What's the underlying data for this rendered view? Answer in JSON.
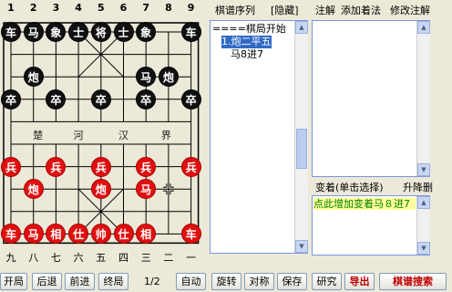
{
  "board": {
    "top_files": [
      "1",
      "2",
      "3",
      "4",
      "5",
      "6",
      "7",
      "8",
      "9"
    ],
    "bottom_files": [
      "九",
      "八",
      "七",
      "六",
      "五",
      "四",
      "三",
      "二",
      "一"
    ],
    "river": [
      "楚",
      "河",
      "汉",
      "界"
    ],
    "pieces": [
      {
        "side": "black",
        "label": "车",
        "col": 0,
        "row": 0
      },
      {
        "side": "black",
        "label": "马",
        "col": 1,
        "row": 0
      },
      {
        "side": "black",
        "label": "象",
        "col": 2,
        "row": 0
      },
      {
        "side": "black",
        "label": "士",
        "col": 3,
        "row": 0
      },
      {
        "side": "black",
        "label": "将",
        "col": 4,
        "row": 0
      },
      {
        "side": "black",
        "label": "士",
        "col": 5,
        "row": 0
      },
      {
        "side": "black",
        "label": "象",
        "col": 6,
        "row": 0
      },
      {
        "side": "black",
        "label": "车",
        "col": 8,
        "row": 0
      },
      {
        "side": "black",
        "label": "炮",
        "col": 1,
        "row": 2
      },
      {
        "side": "black",
        "label": "马",
        "col": 6,
        "row": 2
      },
      {
        "side": "black",
        "label": "炮",
        "col": 7,
        "row": 2
      },
      {
        "side": "black",
        "label": "卒",
        "col": 0,
        "row": 3
      },
      {
        "side": "black",
        "label": "卒",
        "col": 2,
        "row": 3
      },
      {
        "side": "black",
        "label": "卒",
        "col": 4,
        "row": 3
      },
      {
        "side": "black",
        "label": "卒",
        "col": 6,
        "row": 3
      },
      {
        "side": "black",
        "label": "卒",
        "col": 8,
        "row": 3
      },
      {
        "side": "red",
        "label": "兵",
        "col": 0,
        "row": 6
      },
      {
        "side": "red",
        "label": "兵",
        "col": 2,
        "row": 6
      },
      {
        "side": "red",
        "label": "兵",
        "col": 4,
        "row": 6
      },
      {
        "side": "red",
        "label": "兵",
        "col": 6,
        "row": 6
      },
      {
        "side": "red",
        "label": "兵",
        "col": 8,
        "row": 6
      },
      {
        "side": "red",
        "label": "炮",
        "col": 1,
        "row": 7
      },
      {
        "side": "red",
        "label": "炮",
        "col": 4,
        "row": 7
      },
      {
        "side": "red",
        "label": "马",
        "col": 6,
        "row": 7
      },
      {
        "side": "red",
        "label": "车",
        "col": 0,
        "row": 9
      },
      {
        "side": "red",
        "label": "马",
        "col": 1,
        "row": 9
      },
      {
        "side": "red",
        "label": "相",
        "col": 2,
        "row": 9
      },
      {
        "side": "red",
        "label": "仕",
        "col": 3,
        "row": 9
      },
      {
        "side": "red",
        "label": "帅",
        "col": 4,
        "row": 9
      },
      {
        "side": "red",
        "label": "仕",
        "col": 5,
        "row": 9
      },
      {
        "side": "red",
        "label": "相",
        "col": 6,
        "row": 9
      },
      {
        "side": "red",
        "label": "车",
        "col": 8,
        "row": 9
      }
    ]
  },
  "moves_panel": {
    "title": "棋谱序列",
    "hide_label": "[隐藏]",
    "lines": [
      "====棋局开始",
      "1.炮二平五",
      "马8进7"
    ],
    "selected_index": 1
  },
  "comment_panel": {
    "title": "注解",
    "add_label": "添加着法",
    "edit_label": "修改注解"
  },
  "variation_panel": {
    "title": "变着(单击选择)",
    "sort_label": "升降删",
    "lines": [
      "点此增加变着马８进7"
    ]
  },
  "toolbar": {
    "open": "开局",
    "back": "后退",
    "forward": "前进",
    "end": "终局",
    "page": "1/2",
    "auto": "自动",
    "rotate": "旋转",
    "mirror": "对称",
    "save": "保存",
    "study": "研究",
    "export": "导出",
    "search": "棋谱搜索"
  }
}
